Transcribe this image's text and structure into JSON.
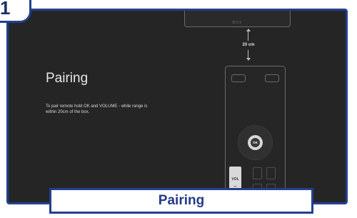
{
  "step": {
    "number": "1"
  },
  "screen": {
    "title": "Pairing",
    "description": "To pair remote hold OK and VOLUME - while range is within 20cm of the box.",
    "box_label": "BOX",
    "distance_label": "20 cm"
  },
  "remote": {
    "ok_label": "OK",
    "vol_label": "VOL",
    "vol_minus": "–"
  },
  "caption": {
    "text": "Pairing"
  },
  "colors": {
    "frame_blue": "#233f8f",
    "screen_bg": "#252525",
    "caption_text": "#223b87"
  }
}
